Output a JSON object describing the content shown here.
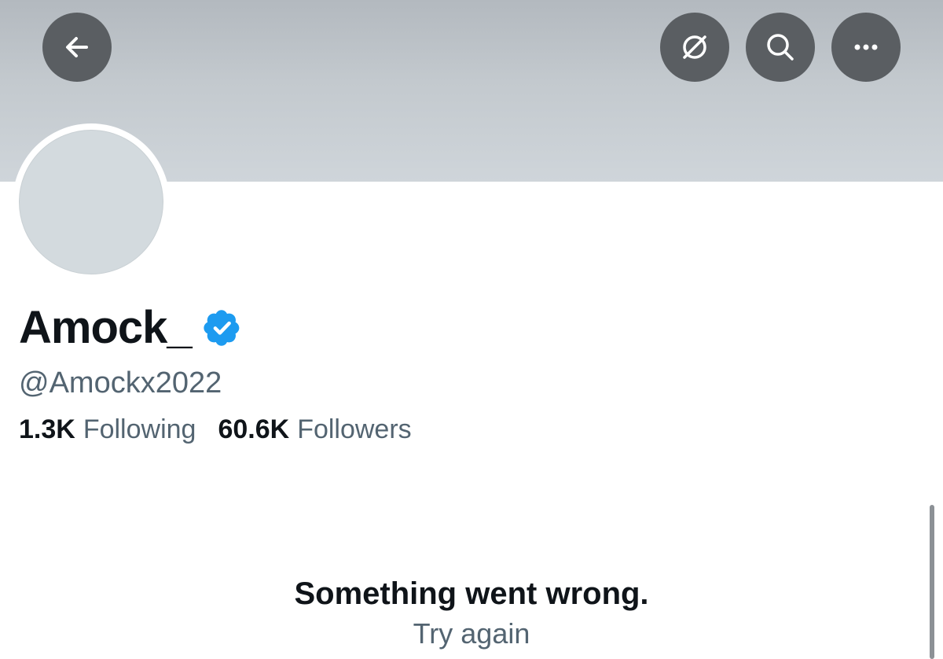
{
  "profile": {
    "display_name": "Amock_",
    "handle": "@Amockx2022",
    "verified": true,
    "following_count": "1.3K",
    "following_label": "Following",
    "followers_count": "60.6K",
    "followers_label": "Followers"
  },
  "header": {
    "buttons": [
      {
        "icon": "back-arrow-icon"
      },
      {
        "icon": "grok-icon"
      },
      {
        "icon": "search-icon"
      },
      {
        "icon": "more-icon"
      }
    ]
  },
  "error": {
    "title": "Something went wrong.",
    "retry_label": "Try again"
  },
  "colors": {
    "text_primary": "#0f1419",
    "text_secondary": "#536471",
    "verified_blue": "#1d9bf0",
    "header_button_bg": "#5a5e62"
  }
}
